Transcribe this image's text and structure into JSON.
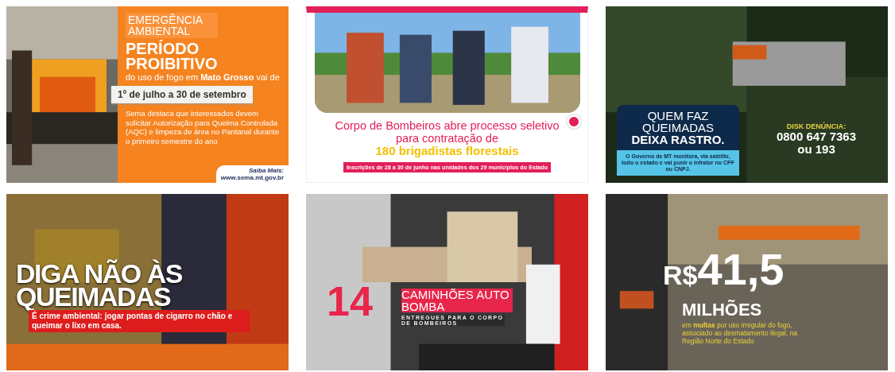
{
  "posters": [
    {
      "kind": "notice",
      "eyebrow": "EMERGÊNCIA AMBIENTAL",
      "headline": "PERÍODO PROIBITIVO",
      "lead": "do uso de fogo em **Mato Grosso** vai de",
      "date": "1º de julho a 30 de setembro",
      "body": "Sema destaca que interessados devem solicitar Autorização para Queima Controlada (AQC) e limpeza de área no Pantanal durante o primeiro semestre do ano",
      "more_label": "Saiba Mais:",
      "link": "www.sema.mt.gov.br"
    },
    {
      "kind": "recruit",
      "headline": "Corpo de Bombeiros abre processo seletivo para contratação de",
      "highlight": "180 brigadistas florestais",
      "banner": "Inscrições de 28 a 30 de junho nas unidades dos 29 municípios do Estado"
    },
    {
      "kind": "trace",
      "headline": "QUEM FAZ QUEIMADAS",
      "headline_bold": "DEIXA RASTRO.",
      "body": "O Governo de MT monitora, via satélite, todo o estado e vai punir o infrator no CPF ou CNPJ.",
      "hotline_label": "DISK DENÚNCIA:",
      "phone": "0800 647 7363",
      "alt_phone": "ou 193"
    },
    {
      "kind": "slogan",
      "headline": "DIGA NÃO ÀS QUEIMADAS",
      "body": "É crime ambiental: jogar pontas de cigarro no chão e queimar o lixo em casa."
    },
    {
      "kind": "trucks",
      "number": "14",
      "title": "CAMINHÕES AUTO BOMBA",
      "subtitle": "ENTREGUES PARA O CORPO DE BOMBEIROS"
    },
    {
      "kind": "fines",
      "currency": "R$",
      "amount": "41,5",
      "unit": "MILHÕES",
      "body": "em **multas** por uso irregular do fogo, associado ao desmatamento ilegal, na Região Norte do Estado"
    }
  ]
}
